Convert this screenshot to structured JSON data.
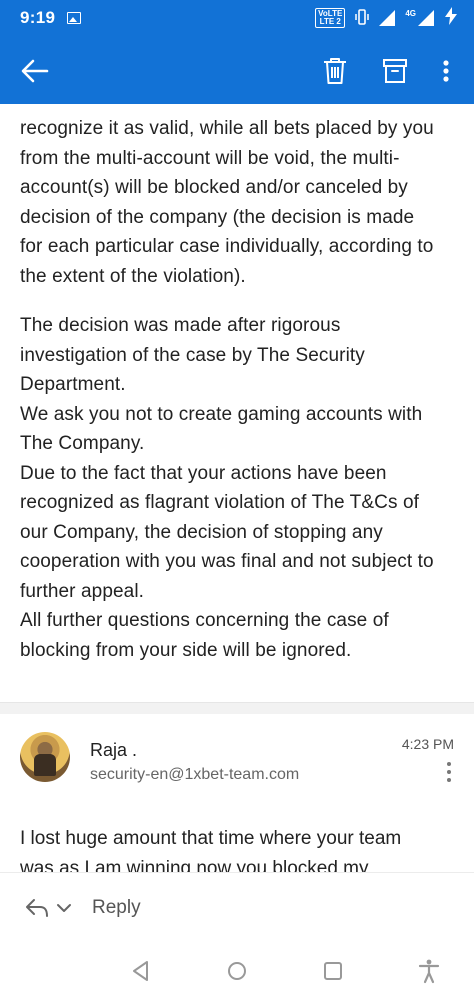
{
  "status_bar": {
    "time": "9:19",
    "volte_top": "VoLTE",
    "volte_bottom": "LTE 2",
    "network": "4G",
    "icons": [
      "image-icon",
      "volte-icon",
      "vibrate-icon",
      "signal-icon",
      "battery-charging-icon"
    ]
  },
  "app_bar": {
    "color": "#1272d6",
    "icons": [
      "back-arrow-icon",
      "trash-icon",
      "archive-icon",
      "more-vert-icon"
    ]
  },
  "message": {
    "paragraph1": [
      "recognize it as valid, while all bets placed by you",
      "from the multi-account will be void, the multi-",
      "account(s) will be blocked and/or canceled by",
      "decision of the company (the decision is made",
      "for each particular case individually, according to",
      "the extent of the violation)."
    ],
    "paragraph2": [
      "The decision was made after rigorous",
      "investigation of the case by The Security",
      "Department.",
      "We ask you not to create gaming accounts with",
      "The Company.",
      "Due to the fact that your actions have been",
      "recognized as flagrant violation of The T&Cs of",
      "our Company, the decision of stopping any",
      "cooperation with you was final and not subject to",
      "further appeal.",
      "All further questions concerning the case of",
      "blocking from your side will be ignored."
    ]
  },
  "reply_message": {
    "sender_name": "Raja .",
    "sender_email": "security-en@1xbet-team.com",
    "time": "4:23 PM",
    "preview": [
      "I lost huge amount that time where your team",
      "was as I am winning now you blocked my"
    ]
  },
  "reply_bar": {
    "label": "Reply"
  },
  "nav_bar": {
    "icons": [
      "back-triangle-icon",
      "home-circle-icon",
      "recents-square-icon",
      "accessibility-icon"
    ]
  }
}
